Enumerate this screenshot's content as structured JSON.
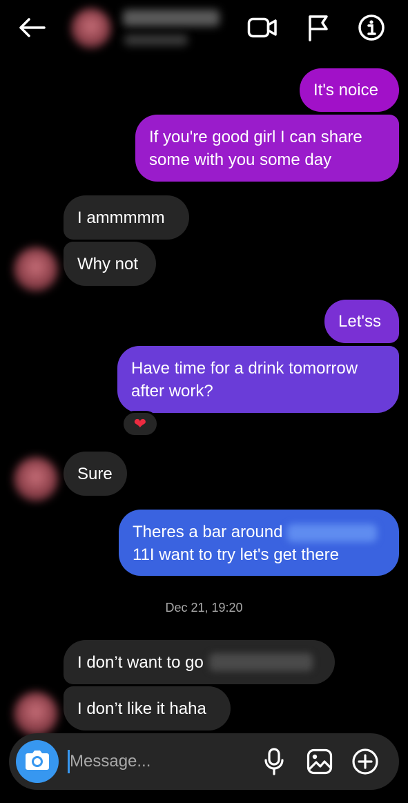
{
  "header": {
    "icons": [
      "back-arrow-icon",
      "video-call-icon",
      "flag-icon",
      "info-icon"
    ]
  },
  "messages": [
    {
      "direction": "out",
      "text": "It's noice",
      "color": "#a111c8"
    },
    {
      "direction": "out",
      "lines": [
        "If you're good girl I can share",
        "some with you some day"
      ],
      "color": "#9a1ccb"
    },
    {
      "direction": "in",
      "text": "I ammmmm",
      "color": "#262626"
    },
    {
      "direction": "in",
      "text": "Why not",
      "color": "#262626"
    },
    {
      "direction": "out",
      "text": "Let'ss",
      "color": "#7a30d4"
    },
    {
      "direction": "out",
      "lines": [
        "Have time for a drink tomorrow",
        "after work?"
      ],
      "color": "#6a3cd8",
      "reaction": "❤"
    },
    {
      "direction": "in",
      "text": "Sure",
      "color": "#262626"
    },
    {
      "direction": "out",
      "lines": [
        "Theres a bar around",
        "11I want to try let's get there"
      ],
      "color": "#3a63e0"
    },
    {
      "direction": "in",
      "text": "I don’t want to go",
      "color": "#262626"
    },
    {
      "direction": "in",
      "text": "I don’t like it haha",
      "color": "#262626"
    }
  ],
  "timestamp": "Dec 21, 19:20",
  "composer": {
    "placeholder": "Message...",
    "icons": [
      "camera-icon",
      "microphone-icon",
      "gallery-icon",
      "plus-icon"
    ]
  },
  "colors": {
    "background": "#000000",
    "incoming_bubble": "#262626",
    "accent": "#3797f0",
    "timestamp": "#a8a8a8"
  }
}
